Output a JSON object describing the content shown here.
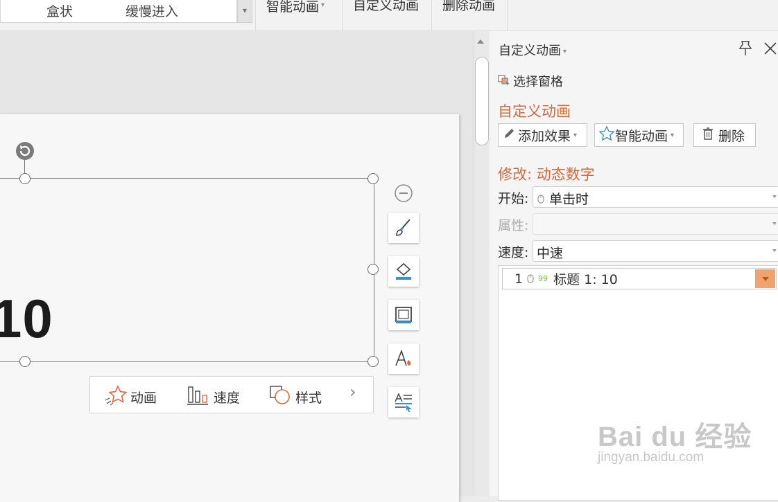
{
  "ribbon": {
    "gallery_items": [
      "盒状",
      "缓慢进入"
    ],
    "smart_animation": "智能动画",
    "custom_animation": "自定义动画",
    "delete_animation": "删除动画"
  },
  "slide": {
    "text_content": "10",
    "quick_bar": {
      "animation": "动画",
      "speed": "速度",
      "style": "样式",
      "more": "›"
    }
  },
  "pane": {
    "title": "自定义动画",
    "selection_pane": "选择窗格",
    "section_title": "自定义动画",
    "add_effect": "添加效果",
    "smart_animation": "智能动画",
    "delete": "删除",
    "modify_title": "修改: 动态数字",
    "start_label": "开始:",
    "start_value": "单击时",
    "property_label": "属性:",
    "property_value": "",
    "speed_label": "速度:",
    "speed_value": "中速",
    "animation_items": [
      {
        "index": "1",
        "label": "标题 1: 10"
      }
    ]
  },
  "watermark": {
    "brand": "Bai du 经验",
    "url": "jingyan.baidu.com"
  },
  "colors": {
    "accent_orange": "#d6693c",
    "item_dropdown": "#f0a36c"
  },
  "icons": [
    "pin-icon",
    "close-icon",
    "pencil-icon",
    "star-icon",
    "trash-icon",
    "mouse-icon",
    "brush-icon",
    "fill-icon",
    "outline-icon",
    "text-effect-icon",
    "text-format-icon",
    "minus-circle-icon",
    "rotate-icon"
  ]
}
